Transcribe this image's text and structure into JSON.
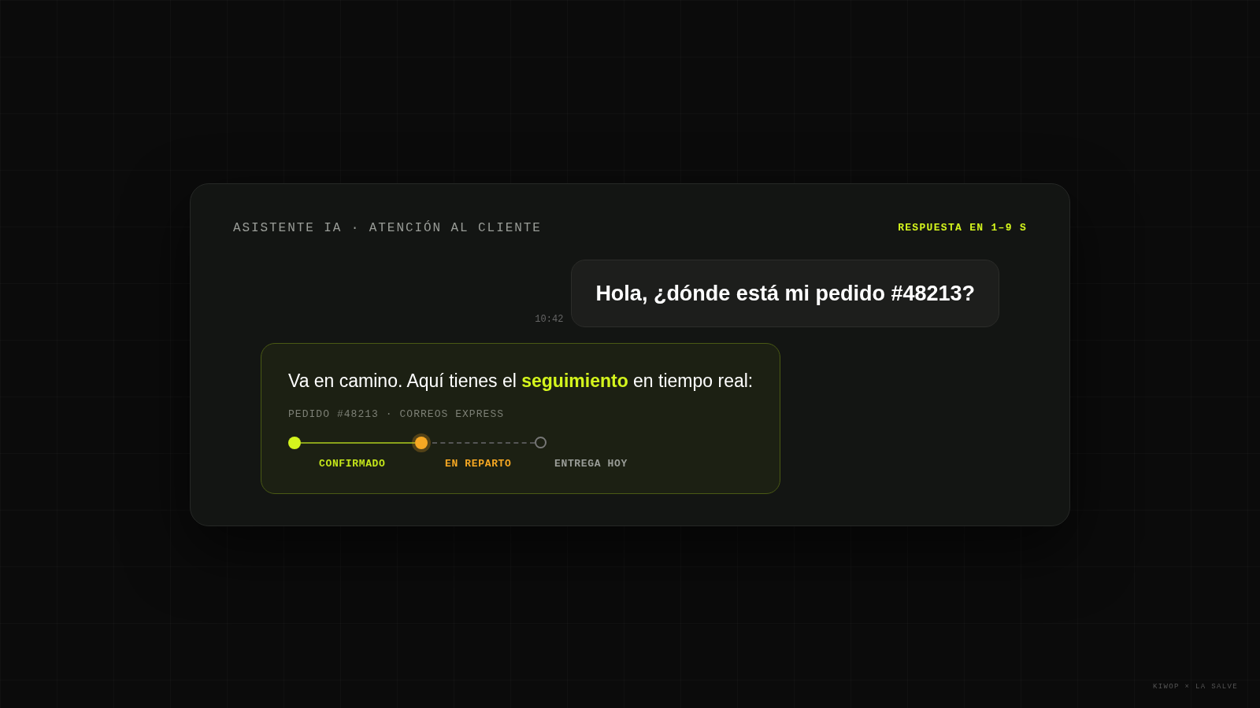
{
  "header": {
    "title": "ASISTENTE IA · ATENCIÓN AL CLIENTE",
    "response_time": "RESPUESTA EN 1–9 S"
  },
  "messages": [
    {
      "kind": "user",
      "text": "Hola, ¿dónde está mi pedido #48213?",
      "time": "10:42"
    },
    {
      "kind": "bot",
      "text": "Va en camino. Aquí tienes el **seguimiento** en tiempo real:",
      "order": "PEDIDO #48213 · CORREOS EXPRESS",
      "steps": [
        {
          "label": "CONFIRMADO",
          "kind": "done"
        },
        {
          "label": "EN REPARTO",
          "kind": "active"
        },
        {
          "label": "ENTREGA HOY",
          "kind": "pending"
        }
      ]
    }
  ],
  "footer": "KIWOP × LA SALVE"
}
